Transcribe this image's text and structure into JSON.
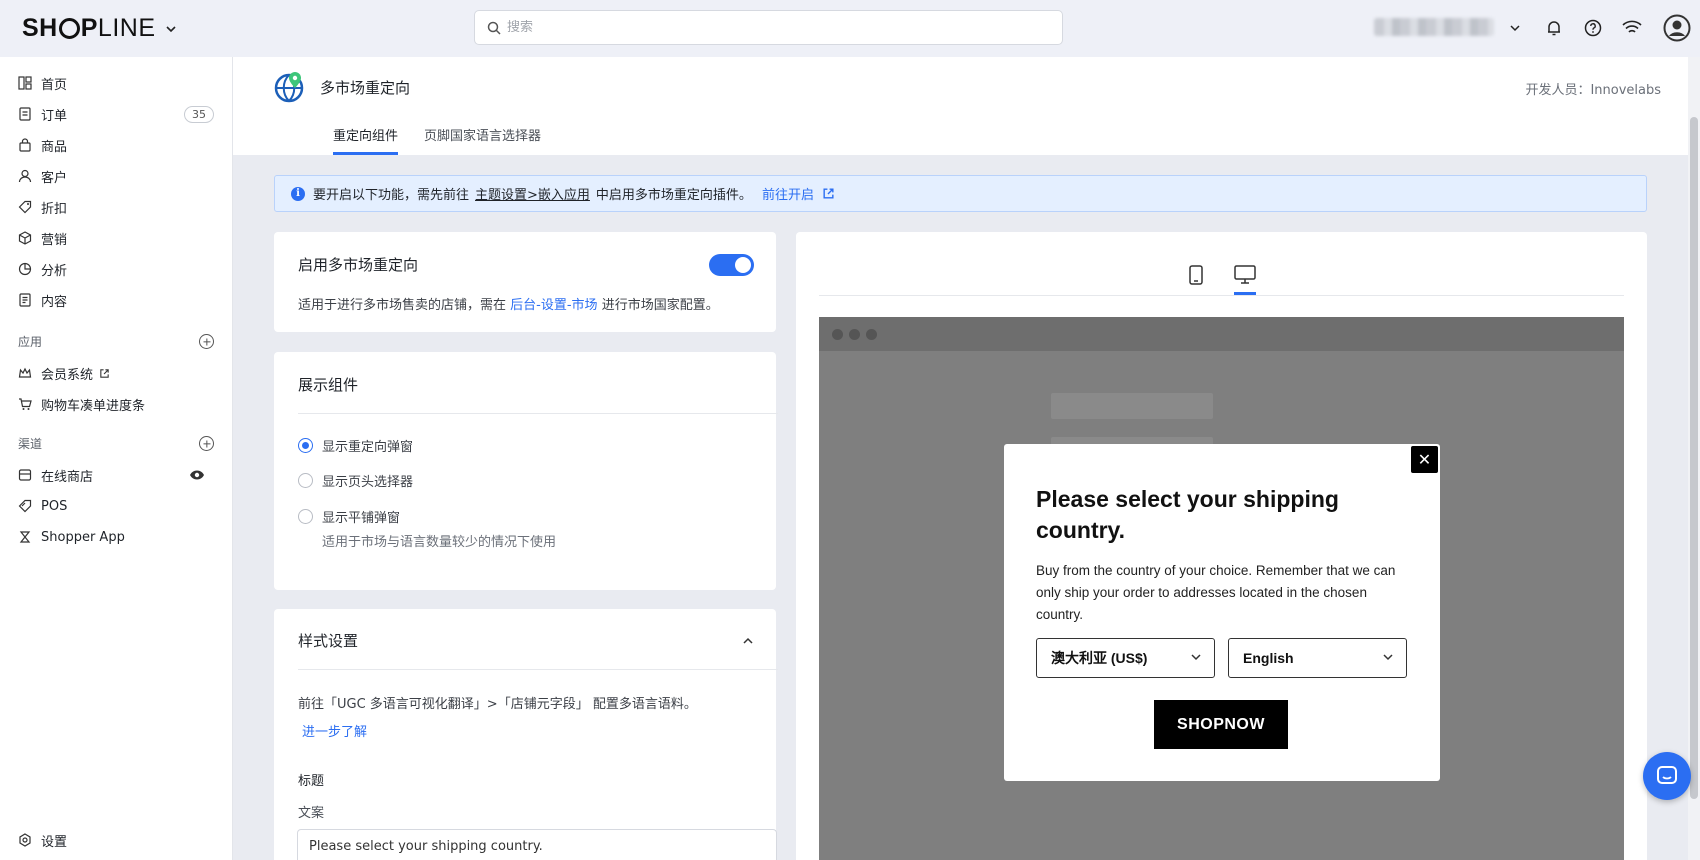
{
  "brand": {
    "logo_bold": "SH",
    "logo_light_prefix": "O",
    "logo_rest_bold": "P",
    "logo_rest": "LINE"
  },
  "search": {
    "placeholder": "搜索"
  },
  "sidebar": {
    "items": [
      {
        "label": "首页",
        "icon": "home-icon"
      },
      {
        "label": "订单",
        "icon": "order-icon",
        "badge": "35"
      },
      {
        "label": "商品",
        "icon": "bag-icon"
      },
      {
        "label": "客户",
        "icon": "user-icon"
      },
      {
        "label": "折扣",
        "icon": "tag-icon"
      },
      {
        "label": "营销",
        "icon": "cube-icon"
      },
      {
        "label": "分析",
        "icon": "pie-icon"
      },
      {
        "label": "内容",
        "icon": "document-icon"
      }
    ],
    "apps_section": "应用",
    "apps": [
      {
        "label": "会员系统",
        "icon": "crown-icon"
      },
      {
        "label": "购物车凑单进度条",
        "icon": "cart-icon"
      }
    ],
    "channels_section": "渠道",
    "channels": [
      {
        "label": "在线商店",
        "icon": "store-icon"
      },
      {
        "label": "POS",
        "icon": "pos-icon"
      },
      {
        "label": "Shopper App",
        "icon": "shopper-app-icon"
      }
    ],
    "settings": "设置"
  },
  "header": {
    "title": "多市场重定向",
    "developer": "开发人员：Innovelabs",
    "tabs": [
      "重定向组件",
      "页脚国家语言选择器"
    ]
  },
  "banner": {
    "text_before": "要开启以下功能，需先前往",
    "link_theme": "主题设置>嵌入应用",
    "text_after": "中启用多市场重定向插件。",
    "action": "前往开启"
  },
  "enable_card": {
    "title": "启用多市场重定向",
    "desc_before": "适用于进行多市场售卖的店铺，需在",
    "desc_link": "后台-设置-市场",
    "desc_after": "进行市场国家配置。",
    "enabled": true
  },
  "display_card": {
    "title": "展示组件",
    "options": [
      {
        "label": "显示重定向弹窗",
        "selected": true
      },
      {
        "label": "显示页头选择器",
        "selected": false
      },
      {
        "label": "显示平铺弹窗",
        "selected": false,
        "hint": "适用于市场与语言数量较少的情况下使用"
      }
    ]
  },
  "style_card": {
    "title": "样式设置",
    "desc": "前往「UGC 多语言可视化翻译」>「店铺元字段」 配置多语言语料。",
    "learn_more": "进一步了解",
    "section_title": "标题",
    "field_label": "文案",
    "field_value": "Please select your shipping country."
  },
  "preview": {
    "modal_title": "Please select your shipping country.",
    "modal_body": "Buy from the country of your choice. Remember that we can only ship your order to addresses located in the chosen country.",
    "country_select": "澳大利亚 (US$)",
    "language_select": "English",
    "button": "SHOPNOW",
    "close": "✕"
  }
}
